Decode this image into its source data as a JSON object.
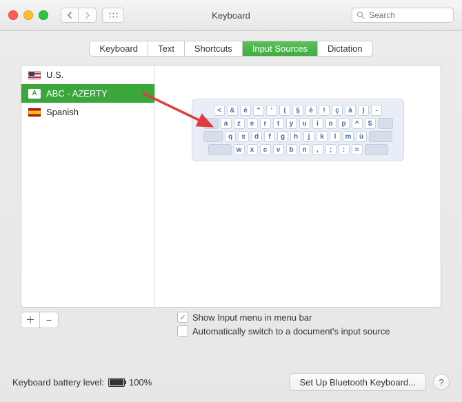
{
  "window": {
    "title": "Keyboard"
  },
  "search": {
    "placeholder": "Search",
    "value": ""
  },
  "tabs": [
    {
      "label": "Keyboard",
      "active": false
    },
    {
      "label": "Text",
      "active": false
    },
    {
      "label": "Shortcuts",
      "active": false
    },
    {
      "label": "Input Sources",
      "active": true
    },
    {
      "label": "Dictation",
      "active": false
    }
  ],
  "sources": [
    {
      "flag": "us",
      "label": "U.S.",
      "selected": false
    },
    {
      "flag": "abc",
      "label": "ABC - AZERTY",
      "selected": true
    },
    {
      "flag": "es",
      "label": "Spanish",
      "selected": false
    }
  ],
  "keyboard_rows": [
    [
      "<",
      "&",
      "é",
      "\"",
      "'",
      "(",
      "§",
      "è",
      "!",
      "ç",
      "à",
      ")",
      "-"
    ],
    [
      "a",
      "z",
      "e",
      "r",
      "t",
      "y",
      "u",
      "i",
      "o",
      "p",
      "^",
      "$"
    ],
    [
      "q",
      "s",
      "d",
      "f",
      "g",
      "h",
      "j",
      "k",
      "l",
      "m",
      "ù"
    ],
    [
      "w",
      "x",
      "c",
      "v",
      "b",
      "n",
      ",",
      ";",
      ":",
      "="
    ]
  ],
  "checks": {
    "show_menu": {
      "label": "Show Input menu in menu bar",
      "checked": true
    },
    "auto_switch": {
      "label": "Automatically switch to a document's input source",
      "checked": false
    }
  },
  "battery": {
    "label": "Keyboard battery level:",
    "level": "100%"
  },
  "bluetooth_btn": "Set Up Bluetooth Keyboard...",
  "abc_badge": "A"
}
